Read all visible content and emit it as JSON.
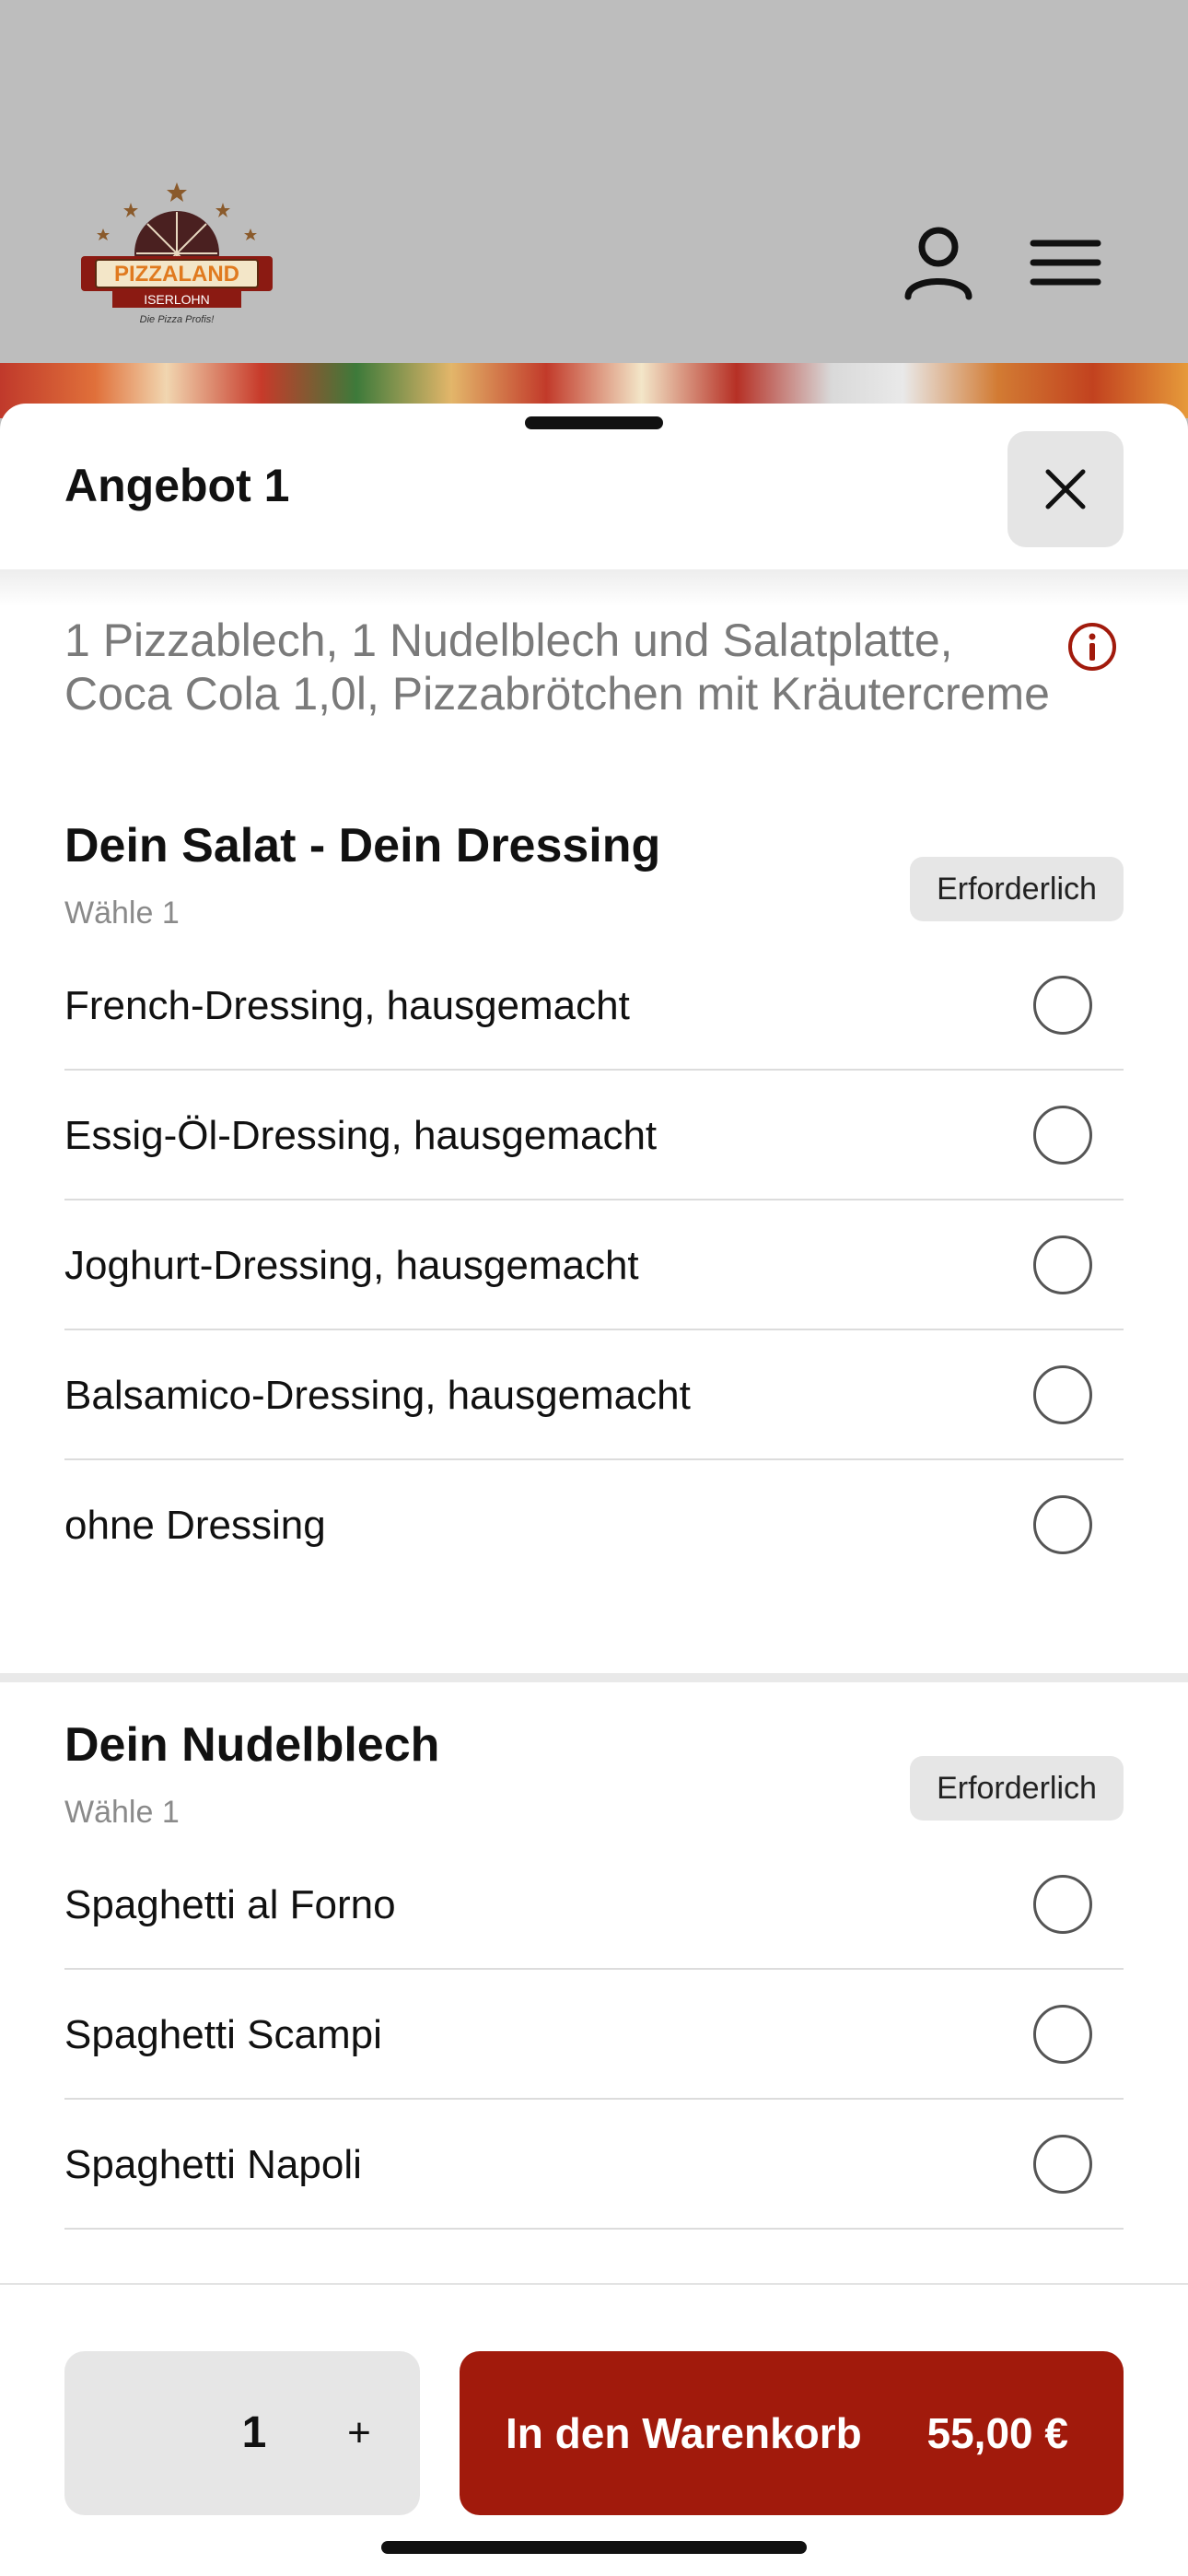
{
  "header": {
    "logo": {
      "brand": "PIZZALAND",
      "city": "ISERLOHN",
      "tagline": "Die Pizza Profis!"
    },
    "account_icon": "person-icon",
    "menu_icon": "hamburger-menu-icon"
  },
  "sheet": {
    "title": "Angebot 1",
    "close_icon": "close-icon",
    "description_line1": "1 Pizzablech, 1 Nudelblech und Salatplatte,",
    "description_line2": "Coca Cola 1,0l, Pizzabrötchen mit Kräutercreme",
    "info_icon": "info-icon"
  },
  "sections": [
    {
      "title": "Dein Salat - Dein Dressing",
      "subtitle": "Wähle 1",
      "badge": "Erforderlich",
      "options": [
        "French-Dressing, hausgemacht",
        "Essig-Öl-Dressing, hausgemacht",
        "Joghurt-Dressing, hausgemacht",
        "Balsamico-Dressing, hausgemacht",
        "ohne Dressing"
      ]
    },
    {
      "title": "Dein Nudelblech",
      "subtitle": "Wähle 1",
      "badge": "Erforderlich",
      "options": [
        "Spaghetti al Forno",
        "Spaghetti Scampi",
        "Spaghetti Napoli"
      ]
    }
  ],
  "footer": {
    "quantity": "1",
    "plus_label": "+",
    "cart_label": "In den Warenkorb",
    "price": "55,00 €"
  },
  "colors": {
    "accent": "#a11a0c",
    "header_bg": "#bdbdbd",
    "chip_bg": "#e6e6e6"
  }
}
